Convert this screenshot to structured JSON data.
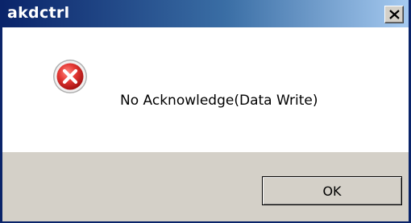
{
  "window": {
    "title": "akdctrl",
    "close_icon": "close-icon",
    "colors": {
      "titlebar_start": "#0a246a",
      "titlebar_end": "#a6caf0",
      "dialog_face": "#d4d0c8",
      "content_bg": "#ffffff"
    }
  },
  "message": {
    "icon": "error-icon",
    "text": "No Acknowledge(Data Write)"
  },
  "buttons": {
    "ok_label": "OK"
  }
}
